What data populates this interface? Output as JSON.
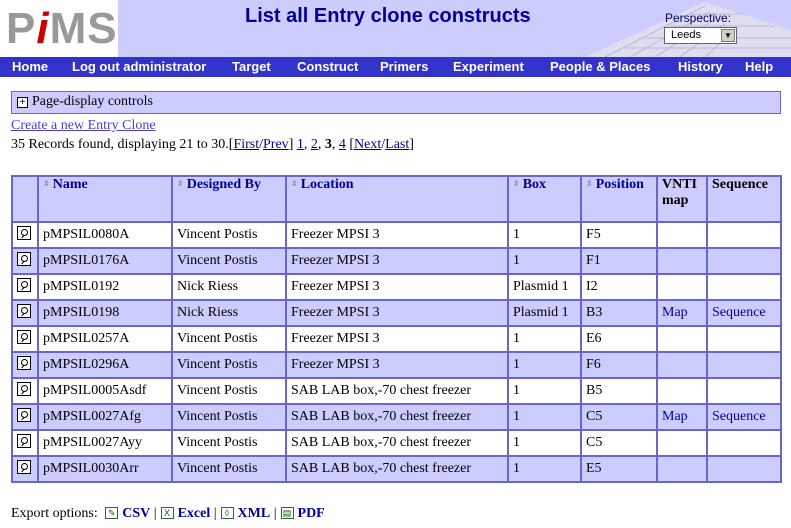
{
  "header": {
    "logo_text": {
      "p": "P",
      "i": "i",
      "ms": "MS"
    },
    "title": "List all Entry clone constructs",
    "perspective_label": "Perspective:",
    "perspective_value": "Leeds"
  },
  "nav": {
    "items": [
      {
        "label": "Home"
      },
      {
        "label": "Log out administrator"
      },
      {
        "label": "Target"
      },
      {
        "label": "Construct"
      },
      {
        "label": "Primers"
      },
      {
        "label": "Experiment"
      },
      {
        "label": "People & Places"
      },
      {
        "label": "History"
      },
      {
        "label": "Help"
      }
    ]
  },
  "controls": {
    "label": "Page-display controls"
  },
  "create_link": "Create a new Entry Clone",
  "records": {
    "text": "35 Records found, displaying 21 to 30.",
    "first": "First",
    "prev": "Prev",
    "pages": [
      "1",
      "2",
      "3",
      "4"
    ],
    "current": "3",
    "next": "Next",
    "last": "Last"
  },
  "table": {
    "headers": {
      "name": "Name",
      "designed_by": "Designed By",
      "location": "Location",
      "box": "Box",
      "position": "Position",
      "vnti_line1": "VNTI",
      "vnti_line2": "map",
      "sequence": "Sequence"
    },
    "rows": [
      {
        "name": "pMPSIL0080A",
        "designed_by": "Vincent Postis",
        "location": "Freezer MPSI 3",
        "box": "1",
        "position": "F5",
        "vnti": "",
        "sequence": ""
      },
      {
        "name": "pMPSIL0176A",
        "designed_by": "Vincent Postis",
        "location": "Freezer MPSI 3",
        "box": "1",
        "position": "F1",
        "vnti": "",
        "sequence": ""
      },
      {
        "name": "pMPSIL0192",
        "designed_by": "Nick Riess",
        "location": "Freezer MPSI 3",
        "box": "Plasmid 1",
        "position": "I2",
        "vnti": "",
        "sequence": ""
      },
      {
        "name": "pMPSIL0198",
        "designed_by": "Nick Riess",
        "location": "Freezer MPSI 3",
        "box": "Plasmid 1",
        "position": "B3",
        "vnti": "Map",
        "sequence": "Sequence"
      },
      {
        "name": "pMPSIL0257A",
        "designed_by": "Vincent Postis",
        "location": "Freezer MPSI 3",
        "box": "1",
        "position": "E6",
        "vnti": "",
        "sequence": ""
      },
      {
        "name": "pMPSIL0296A",
        "designed_by": "Vincent Postis",
        "location": "Freezer MPSI 3",
        "box": "1",
        "position": "F6",
        "vnti": "",
        "sequence": ""
      },
      {
        "name": "pMPSIL0005Asdf",
        "designed_by": "Vincent Postis",
        "location": "SAB LAB box,-70 chest freezer",
        "box": "1",
        "position": "B5",
        "vnti": "",
        "sequence": ""
      },
      {
        "name": "pMPSIL0027Afg",
        "designed_by": "Vincent Postis",
        "location": "SAB LAB box,-70 chest freezer",
        "box": "1",
        "position": "C5",
        "vnti": "Map",
        "sequence": "Sequence"
      },
      {
        "name": "pMPSIL0027Ayy",
        "designed_by": "Vincent Postis",
        "location": "SAB LAB box,-70 chest freezer",
        "box": "1",
        "position": "C5",
        "vnti": "",
        "sequence": ""
      },
      {
        "name": "pMPSIL0030Arr",
        "designed_by": "Vincent Postis",
        "location": "SAB LAB box,-70 chest freezer",
        "box": "1",
        "position": "E5",
        "vnti": "",
        "sequence": ""
      }
    ]
  },
  "export": {
    "label": "Export options:",
    "options": [
      {
        "label": "CSV",
        "icon": "csv-icon"
      },
      {
        "label": "Excel",
        "icon": "excel-icon"
      },
      {
        "label": "XML",
        "icon": "xml-icon"
      },
      {
        "label": "PDF",
        "icon": "pdf-icon"
      }
    ]
  }
}
